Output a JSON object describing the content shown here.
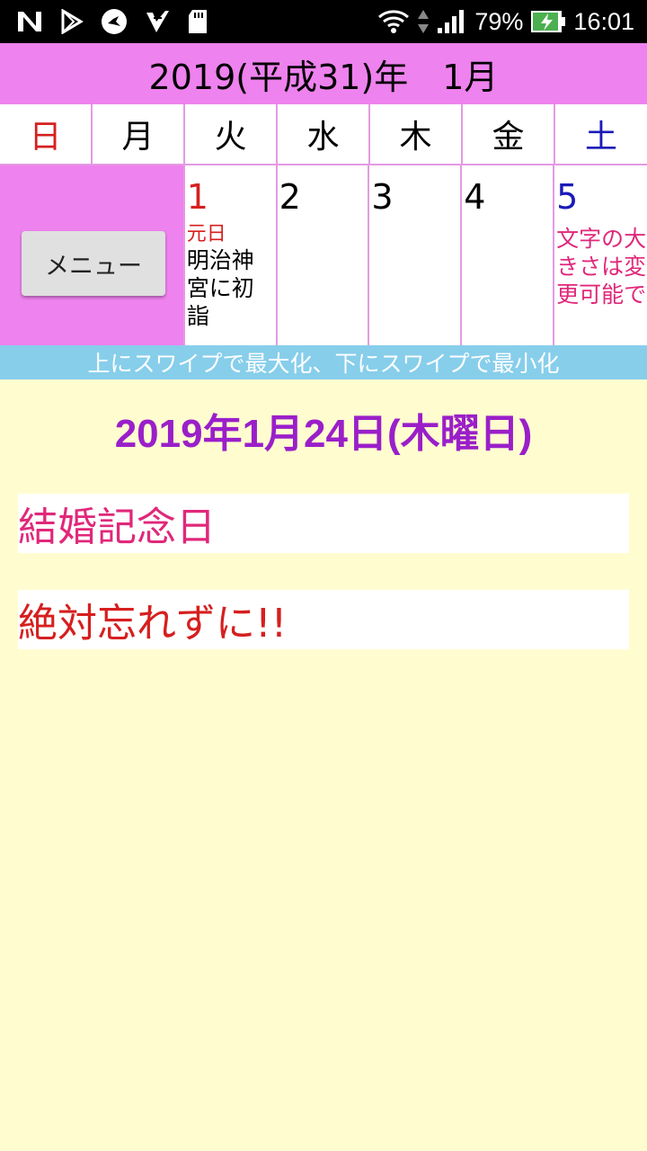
{
  "status_bar": {
    "left_icons": [
      "n-icon",
      "play-store-icon",
      "bird-app-icon",
      "check-app-icon",
      "sd-card-icon"
    ],
    "battery_percent": "79%",
    "time": "16:01"
  },
  "calendar": {
    "month_title": "2019(平成31)年　1月",
    "weekdays": [
      {
        "label": "日",
        "color": "#d61f1f"
      },
      {
        "label": "月",
        "color": "#000000"
      },
      {
        "label": "火",
        "color": "#000000"
      },
      {
        "label": "水",
        "color": "#000000"
      },
      {
        "label": "木",
        "color": "#000000"
      },
      {
        "label": "金",
        "color": "#000000"
      },
      {
        "label": "土",
        "color": "#1a1ab8"
      }
    ],
    "menu_button": "メニュー",
    "days": [
      {
        "num": "1",
        "color": "#d61f1f",
        "holiday": "元日",
        "event": "明治神宮に初詣",
        "event_color": "#000000"
      },
      {
        "num": "2",
        "color": "#000000",
        "holiday": "",
        "event": "",
        "event_color": "#000000"
      },
      {
        "num": "3",
        "color": "#000000",
        "holiday": "",
        "event": "",
        "event_color": "#000000"
      },
      {
        "num": "4",
        "color": "#000000",
        "holiday": "",
        "event": "",
        "event_color": "#000000"
      },
      {
        "num": "5",
        "color": "#1a1ab8",
        "holiday": "",
        "event": "文字の大きさは変更可能で",
        "event_color": "#e0287a"
      }
    ],
    "swipe_hint": "上にスワイプで最大化、下にスワイプで最小化"
  },
  "detail": {
    "date_title": "2019年1月24日(木曜日)",
    "memos": [
      {
        "text": "結婚記念日",
        "color": "#e0287a"
      },
      {
        "text": "絶対忘れずに!!",
        "color": "#d61f1f"
      }
    ]
  }
}
